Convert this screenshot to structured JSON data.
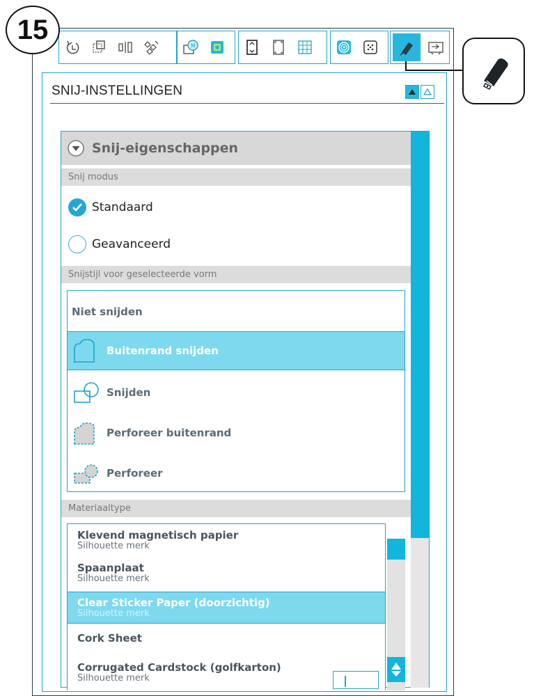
{
  "step": {
    "number": "15"
  },
  "toolbar": {
    "groups": [
      [
        "rotate",
        "transform",
        "align",
        "replicate"
      ],
      [
        "modify",
        "offset"
      ],
      [
        "page",
        "page-fit",
        "grid"
      ],
      [
        "trace",
        "pixscan"
      ],
      [
        "cut-settings",
        "send"
      ]
    ],
    "active": "cut-settings"
  },
  "panel": {
    "title": "SNIJ-INSTELLINGEN"
  },
  "cut_properties": {
    "title": "Snij-eigenschappen",
    "mode_header": "Snij modus",
    "modes": [
      {
        "label": "Standaard",
        "selected": true
      },
      {
        "label": "Geavanceerd",
        "selected": false
      }
    ],
    "style_header": "Snijstijl voor geselecteerde vorm",
    "styles": [
      {
        "label": "Niet snijden",
        "icon": "none",
        "selected": false
      },
      {
        "label": "Buitenrand snijden",
        "icon": "cut-edge-icon",
        "selected": true
      },
      {
        "label": "Snijden",
        "icon": "cut-icon",
        "selected": false
      },
      {
        "label": "Perforeer buitenrand",
        "icon": "perforate-edge-icon",
        "selected": false
      },
      {
        "label": "Perforeer",
        "icon": "perforate-icon",
        "selected": false
      }
    ],
    "material_header": "Materiaaltype",
    "materials": [
      {
        "name": "Klevend magnetisch papier",
        "brand": "Silhouette merk",
        "selected": false
      },
      {
        "name": "Spaanplaat",
        "brand": "Silhouette merk",
        "selected": false
      },
      {
        "name": "Clear Sticker Paper (doorzichtig)",
        "brand": "Silhouette merk",
        "selected": true
      },
      {
        "name": "Cork Sheet",
        "brand": "",
        "selected": false
      },
      {
        "name": "Corrugated Cardstock (golfkarton)",
        "brand": "Silhouette merk",
        "selected": false
      }
    ]
  },
  "colors": {
    "accent": "#1fa4c8",
    "selected_bg": "#7ed9ee",
    "scroll": "#12b5dc",
    "subheader_bg": "#dcdcdc"
  }
}
